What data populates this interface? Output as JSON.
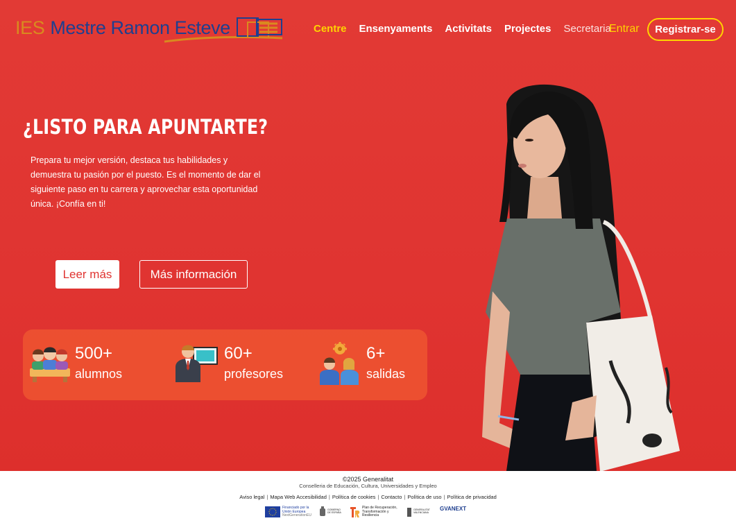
{
  "header": {
    "logo": {
      "prefix": "IES",
      "name": "Mestre Ramon Esteve"
    },
    "nav": [
      {
        "label": "Centre",
        "active": true
      },
      {
        "label": "Ensenyaments"
      },
      {
        "label": "Activitats"
      },
      {
        "label": "Projectes"
      },
      {
        "label": "Secretaria"
      }
    ],
    "login_label": "Entrar",
    "register_label": "Registrar-se"
  },
  "hero": {
    "title": "¿LISTO PARA APUNTARTE?",
    "text": "Prepara tu mejor versión, destaca tus habilidades y demuestra tu pasión por el puesto. Es el momento de dar el siguiente paso en tu carrera y aprovechar esta oportunidad única. ¡Confía en ti!",
    "read_more": "Leer más",
    "more_info": "Más información"
  },
  "stats": [
    {
      "value": "500+",
      "label": "alumnos",
      "icon": "students-icon"
    },
    {
      "value": "60+",
      "label": "profesores",
      "icon": "teacher-icon"
    },
    {
      "value": "6+",
      "label": "salidas",
      "icon": "careers-icon"
    }
  ],
  "footer": {
    "copyright": "©2025 Generalitat",
    "ministry": "Conselleria de Educación, Cultura, Universidades y Empleo",
    "links": [
      "Aviso legal",
      "Mapa Web Accesibilidad",
      "Política de cookies",
      "Contacto",
      "Política de uso",
      "Política de privacidad"
    ],
    "sponsors": {
      "eu": "Financiado por la Unión Europea",
      "eu_sub": "NextGenerationEU",
      "gov": "GOBIERNO DE ESPAÑA",
      "plan": "Plan de Recuperación, Transformación y Resiliencia",
      "gva": "GENERALITAT VALENCIANA",
      "gvanext": "GVANEXT"
    }
  },
  "colors": {
    "hero_background": "#e03431",
    "accent": "#ffd400",
    "logo_blue": "#1f3f8f",
    "logo_orange": "#d98a1f"
  }
}
